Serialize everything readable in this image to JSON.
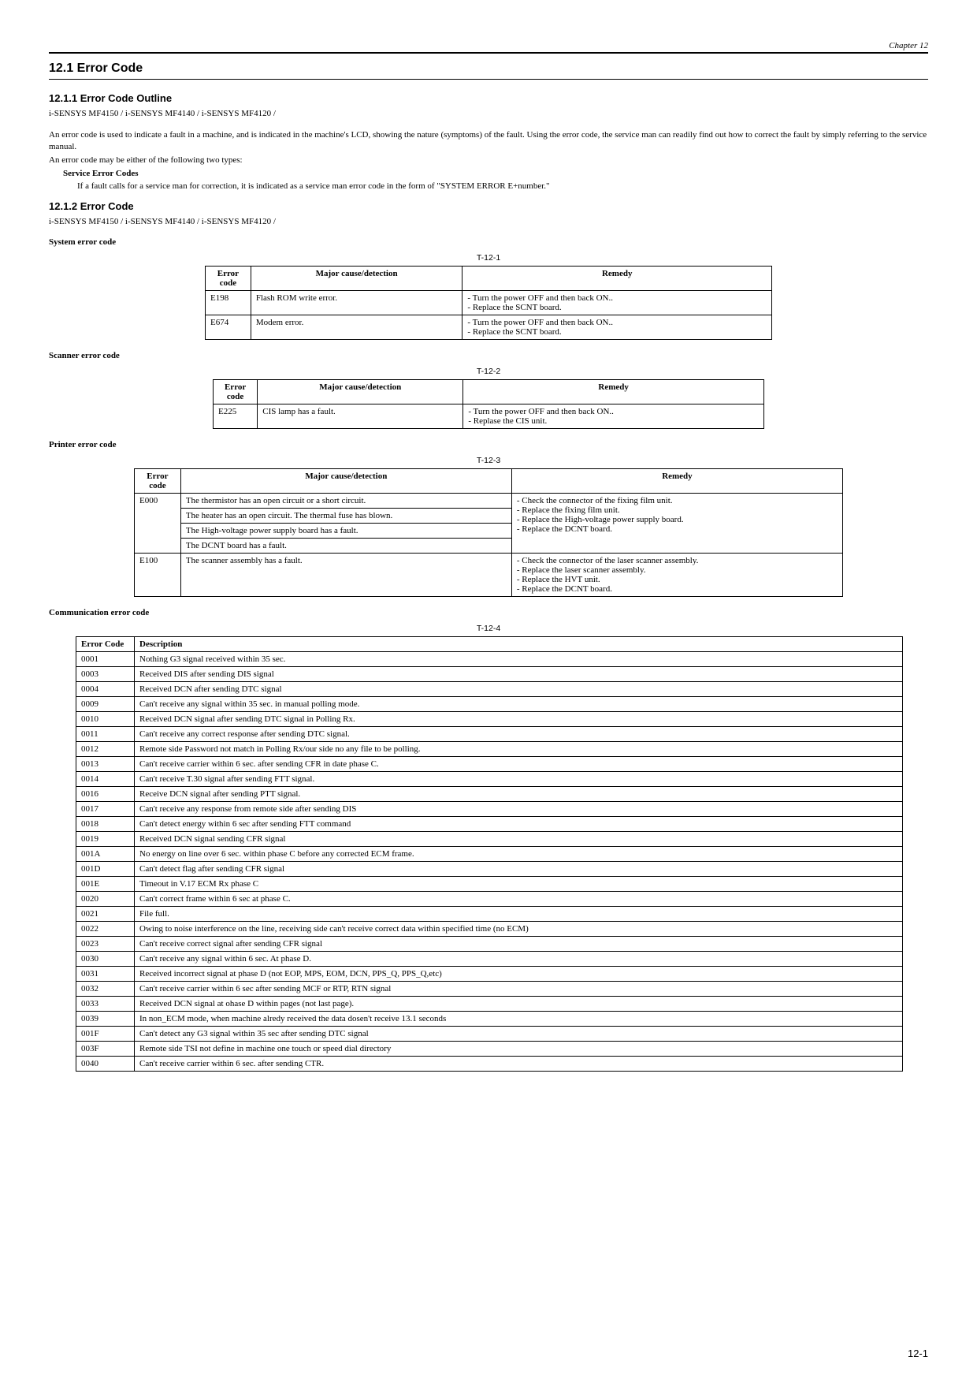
{
  "chapter_header": "Chapter 12",
  "h1": "12.1 Error Code",
  "sec1": {
    "title": "12.1.1 Error Code Outline",
    "models": "i-SENSYS MF4150 / i-SENSYS MF4140 / i-SENSYS MF4120 /",
    "p1": "An error code is used to indicate a fault in a machine, and is indicated in the machine's LCD, showing the nature (symptoms) of the fault. Using the error code, the service man can readily find out how to correct the fault by simply referring to the service manual.",
    "p2": "An error code may be either of the following two types:",
    "sec_label": "Service Error Codes",
    "p3": "If a fault calls for a service man for correction, it is indicated as a service man error code in the form of \"SYSTEM ERROR E+number.\""
  },
  "sec2": {
    "title": "12.1.2 Error Code",
    "models": "i-SENSYS MF4150 / i-SENSYS MF4140 / i-SENSYS MF4120 /"
  },
  "system_label": "System error code",
  "scanner_label": "Scanner error code",
  "printer_label": "Printer error code",
  "comm_label": "Communication error code",
  "tbl1": {
    "caption": "T-12-1",
    "headers": [
      "Error code",
      "Major cause/detection",
      "Remedy"
    ],
    "rows": [
      [
        "E198",
        "Flash ROM write error.",
        "- Turn the power OFF and then back ON..\n- Replace the SCNT board."
      ],
      [
        "E674",
        "Modem error.",
        "- Turn the power OFF and then back ON..\n- Replace the SCNT board."
      ]
    ]
  },
  "tbl2": {
    "caption": "T-12-2",
    "headers": [
      "Error code",
      "Major cause/detection",
      "Remedy"
    ],
    "rows": [
      [
        "E225",
        "CIS lamp has a fault.",
        "- Turn the power OFF and then back ON..\n- Replase the CIS unit."
      ]
    ]
  },
  "tbl3": {
    "caption": "T-12-3",
    "headers": [
      "Error code",
      "Major cause/detection",
      "Remedy"
    ],
    "e000_code": "E000",
    "e000_causes": [
      "The thermistor has an open circuit or a short circuit.",
      "The heater has an open circuit. The thermal fuse has blown.",
      "The High-voltage power supply board has a fault.",
      "The DCNT board has a fault."
    ],
    "e000_remedy": "- Check the connector of the fixing film unit.\n- Replace the fixing film unit.\n- Replace the High-voltage power supply board.\n- Replace the DCNT board.",
    "e100_code": "E100",
    "e100_cause": "The scanner assembly has a fault.",
    "e100_remedy": "- Check the connector of the laser scanner assembly.\n- Replace the laser scanner assembly.\n- Replace the HVT unit.\n- Replace the DCNT board."
  },
  "tbl4": {
    "caption": "T-12-4",
    "headers": [
      "Error Code",
      "Description"
    ],
    "rows": [
      [
        "0001",
        "Nothing G3 signal received within 35 sec."
      ],
      [
        "0003",
        "Received DIS after sending DIS signal"
      ],
      [
        "0004",
        "Received DCN after sending DTC signal"
      ],
      [
        "0009",
        "Can't receive any signal within 35 sec. in manual polling mode."
      ],
      [
        "0010",
        "Received DCN signal after sending DTC signal in Polling Rx."
      ],
      [
        "0011",
        "Can't receive any correct response after sending DTC signal."
      ],
      [
        "0012",
        "Remote side Password not match in Polling Rx/our side no any file to be polling."
      ],
      [
        "0013",
        "Can't receive carrier within 6 sec. after sending CFR in date phase C."
      ],
      [
        "0014",
        "Can't receive T.30 signal after sending FTT signal."
      ],
      [
        "0016",
        "Receive DCN signal after sending PTT signal."
      ],
      [
        "0017",
        "Can't receive any response from remote side after sending DIS"
      ],
      [
        "0018",
        "Can't detect energy within 6 sec after sending FTT command"
      ],
      [
        "0019",
        "Received DCN signal sending CFR signal"
      ],
      [
        "001A",
        "No energy on line over 6 sec. within phase C before any corrected ECM frame."
      ],
      [
        "001D",
        "Can't detect flag after sending CFR signal"
      ],
      [
        "001E",
        "Timeout in V.17 ECM Rx phase C"
      ],
      [
        "0020",
        "Can't correct frame within 6 sec at phase C."
      ],
      [
        "0021",
        "File full."
      ],
      [
        "0022",
        "Owing to noise interference on the line, receiving side can't receive correct data within specified time (no ECM)"
      ],
      [
        "0023",
        "Can't receive correct signal after sending CFR signal"
      ],
      [
        "0030",
        "Can't receive any signal within 6 sec. At phase D."
      ],
      [
        "0031",
        "Received incorrect signal at phase D (not EOP, MPS, EOM, DCN, PPS_Q, PPS_Q,etc)"
      ],
      [
        "0032",
        "Can't receive carrier within 6 sec after sending MCF or RTP, RTN signal"
      ],
      [
        "0033",
        "Received DCN signal at ohase D within pages (not last page)."
      ],
      [
        "0039",
        "In non_ECM mode, when machine alredy received the data dosen't receive 13.1 seconds"
      ],
      [
        "001F",
        "Can't detect any G3 signal within 35 sec after sending DTC signal"
      ],
      [
        "003F",
        "Remote side TSI not define in machine one touch or speed dial directory"
      ],
      [
        "0040",
        "Can't receive carrier within 6 sec. after sending CTR."
      ]
    ]
  },
  "page_number": "12-1"
}
